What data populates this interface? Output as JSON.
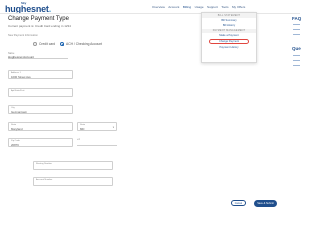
{
  "logo": {
    "sky": "Sky",
    "word_main": "hughes",
    "word_net": "net",
    "dot": "."
  },
  "topnav": {
    "items": [
      "Overview",
      "Account",
      "Billing",
      "Usage",
      "Support",
      "Tools",
      "My Offers"
    ]
  },
  "page": {
    "title": "Change Payment Type",
    "subtitle": "Current payment is: Credit Card ending in 1234",
    "section_label": "New Payment Information"
  },
  "payment_options": {
    "option1": "Credit card",
    "option2": "ACH / Checking Account"
  },
  "account_name": {
    "label": "Name",
    "value": "Hughesnet Account"
  },
  "fields": {
    "address": {
      "label": "Address 1",
      "value": "1000 Street Ave"
    },
    "address2": {
      "label": "Apt/Suite/Unit",
      "value": ""
    },
    "city": {
      "label": "City",
      "value": "Germantown"
    },
    "state": {
      "label": "State",
      "value": "Maryland"
    },
    "state_short": {
      "label": "State",
      "value": "MD"
    },
    "zip": {
      "label": "Zip Code",
      "value": "20876"
    },
    "zip_ext": {
      "label": "+4",
      "value": ""
    },
    "routing": {
      "label": "Routing Number",
      "value": ""
    },
    "account": {
      "label": "Account Number",
      "value": ""
    }
  },
  "buttons": {
    "cancel": "Cancel",
    "save": "Save & Submit"
  },
  "side": {
    "faq": "FAQ",
    "questions": "Que"
  },
  "dropdown": {
    "header1": "BILL STATEMENT",
    "item1": "Bill Summary",
    "item2": "Bill History",
    "header2": "PAYMENT MANAGEMENT",
    "item3": "Make a Payment",
    "item4": "Change Payment",
    "item5": "Payment History"
  },
  "colors": {
    "brand": "#1f4e8c",
    "accent": "#4fa3d8",
    "highlight": "#e0463f"
  }
}
